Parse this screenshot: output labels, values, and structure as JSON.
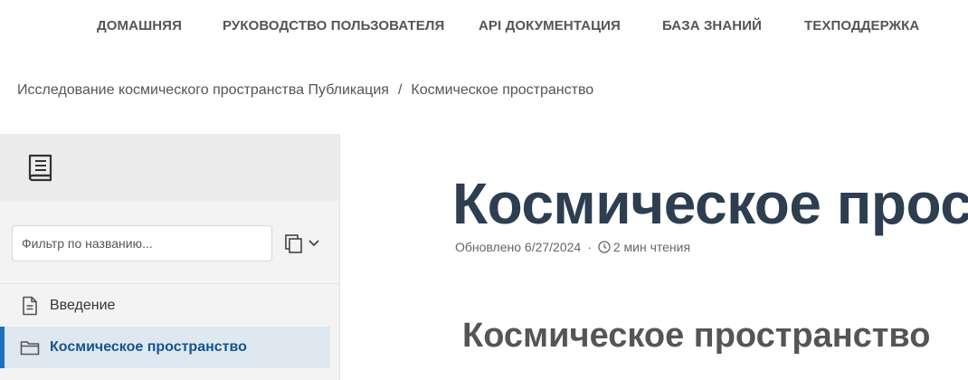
{
  "nav": {
    "items": [
      {
        "label": "ДОМАШНЯЯ"
      },
      {
        "label": "РУКОВОДСТВО ПОЛЬЗОВАТЕЛЯ"
      },
      {
        "label": "API ДОКУМЕНТАЦИЯ"
      },
      {
        "label": "БАЗА ЗНАНИЙ"
      },
      {
        "label": "ТЕХПОДДЕРЖКА"
      }
    ]
  },
  "breadcrumb": {
    "parent": "Исследование космического пространства Публикация",
    "separator": "/",
    "current": "Космическое пространство"
  },
  "sidebar": {
    "logo_icon": "book-icon",
    "filter_placeholder": "Фильтр по названию...",
    "collapse_icon": "copy-chevron-icon",
    "items": [
      {
        "label": "Введение",
        "icon": "document-icon",
        "active": false
      },
      {
        "label": "Космическое пространство",
        "icon": "folder-icon",
        "active": true
      }
    ],
    "accent_color": "#1f6fbf"
  },
  "main": {
    "title": "Космическое пространство",
    "meta": {
      "updated": "Обновлено 6/27/2024",
      "separator": "·",
      "read_time": "2 мин чтения"
    },
    "section_heading": "Космическое пространство"
  }
}
